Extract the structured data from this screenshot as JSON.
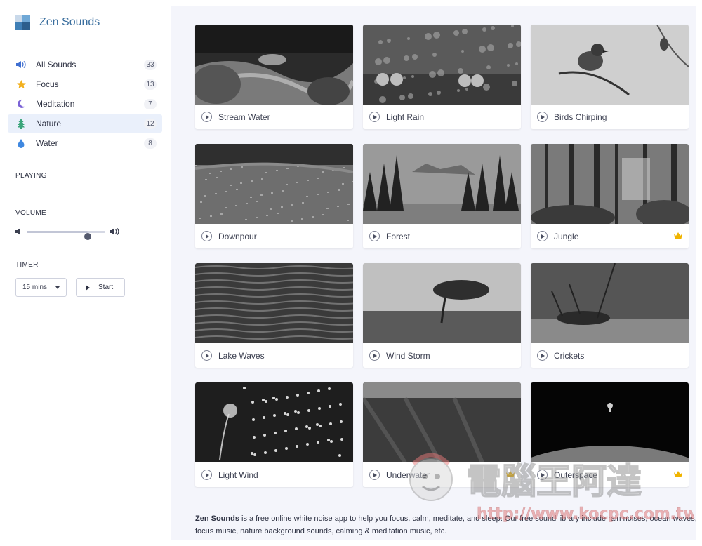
{
  "app": {
    "title": "Zen Sounds"
  },
  "sidebar": {
    "categories": [
      {
        "label": "All Sounds",
        "count": "33",
        "icon": "speaker-icon",
        "active": false
      },
      {
        "label": "Focus",
        "count": "13",
        "icon": "star-icon",
        "active": false
      },
      {
        "label": "Meditation",
        "count": "7",
        "icon": "moon-icon",
        "active": false
      },
      {
        "label": "Nature",
        "count": "12",
        "icon": "tree-icon",
        "active": true
      },
      {
        "label": "Water",
        "count": "8",
        "icon": "droplet-icon",
        "active": false
      }
    ],
    "playing_title": "PLAYING",
    "volume_title": "VOLUME",
    "volume_level": 0.78,
    "timer_title": "TIMER",
    "timer_value": "15 mins",
    "start_label": "Start"
  },
  "sounds": [
    {
      "title": "Stream Water",
      "premium": false,
      "image": "stream"
    },
    {
      "title": "Light Rain",
      "premium": false,
      "image": "rain"
    },
    {
      "title": "Birds Chirping",
      "premium": false,
      "image": "bird"
    },
    {
      "title": "Downpour",
      "premium": false,
      "image": "downpour"
    },
    {
      "title": "Forest",
      "premium": false,
      "image": "forest"
    },
    {
      "title": "Jungle",
      "premium": true,
      "image": "jungle"
    },
    {
      "title": "Lake Waves",
      "premium": false,
      "image": "waves"
    },
    {
      "title": "Wind Storm",
      "premium": false,
      "image": "windtree"
    },
    {
      "title": "Crickets",
      "premium": false,
      "image": "cricket"
    },
    {
      "title": "Light Wind",
      "premium": false,
      "image": "dandelion"
    },
    {
      "title": "Underwater",
      "premium": true,
      "image": "underwater"
    },
    {
      "title": "Outerspace",
      "premium": true,
      "image": "space"
    }
  ],
  "about": {
    "brand": "Zen Sounds",
    "text": " is a free online white noise app to help you focus, calm, meditate, and sleep. Our free sound library include rain noises, ocean waves, focus music, nature background sounds, calming & meditation music, etc."
  },
  "watermark": {
    "title": "電腦王阿達",
    "url": "http://www.kocpc.com.tw"
  },
  "colors": {
    "accent": "#3a6e9e",
    "crown": "#f0b400",
    "nav_active_bg": "#eaf0fb"
  }
}
